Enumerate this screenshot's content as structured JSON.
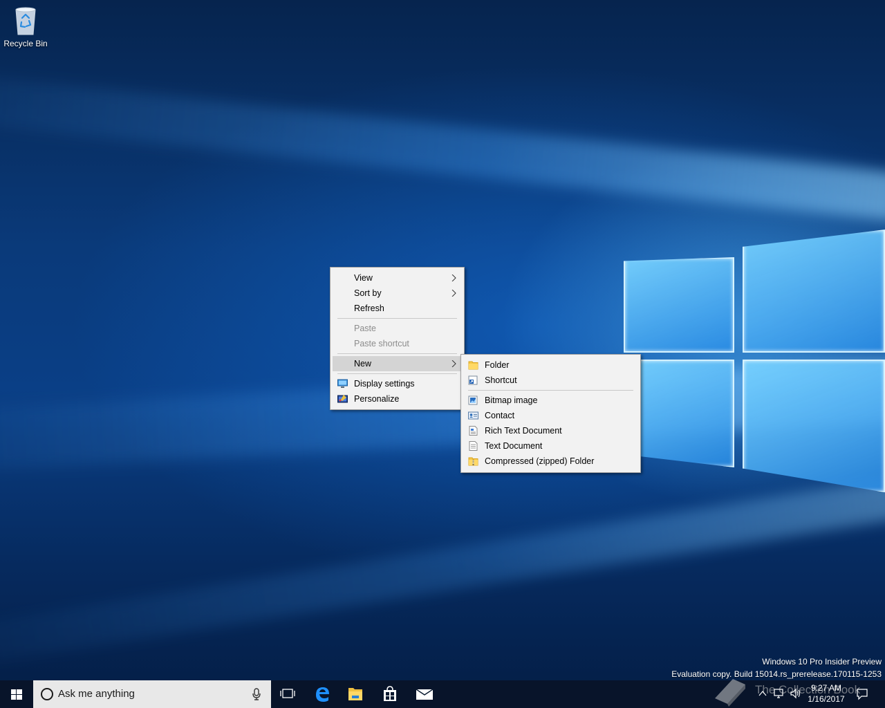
{
  "desktop": {
    "icons": [
      {
        "label": "Recycle Bin",
        "icon": "recycle-bin-icon"
      }
    ],
    "watermark": {
      "line1": "Windows 10 Pro Insider Preview",
      "line2": "Evaluation copy. Build 15014.rs_prerelease.170115-1253"
    }
  },
  "context_menu": {
    "items": [
      {
        "label": "View",
        "submenu": true,
        "enabled": true
      },
      {
        "label": "Sort by",
        "submenu": true,
        "enabled": true
      },
      {
        "label": "Refresh",
        "enabled": true
      },
      {
        "label": "Paste",
        "enabled": false
      },
      {
        "label": "Paste shortcut",
        "enabled": false
      },
      {
        "label": "New",
        "submenu": true,
        "enabled": true,
        "highlighted": true
      },
      {
        "label": "Display settings",
        "icon": "display-icon",
        "enabled": true
      },
      {
        "label": "Personalize",
        "icon": "personalize-icon",
        "enabled": true
      }
    ]
  },
  "new_submenu": {
    "items": [
      {
        "label": "Folder",
        "icon": "folder-icon"
      },
      {
        "label": "Shortcut",
        "icon": "shortcut-icon"
      },
      {
        "label": "Bitmap image",
        "icon": "bitmap-icon"
      },
      {
        "label": "Contact",
        "icon": "contact-icon"
      },
      {
        "label": "Rich Text Document",
        "icon": "rtf-document-icon"
      },
      {
        "label": "Text Document",
        "icon": "text-document-icon"
      },
      {
        "label": "Compressed (zipped) Folder",
        "icon": "zip-folder-icon"
      }
    ]
  },
  "taskbar": {
    "search_placeholder": "Ask me anything",
    "pinned": [
      "task-view-icon",
      "edge-icon",
      "file-explorer-icon",
      "store-icon",
      "mail-icon"
    ],
    "clock": {
      "time": "9:27 AM",
      "date": "1/16/2017"
    },
    "overlay_watermark": "The Collection Book"
  },
  "colors": {
    "accent": "#0078d7",
    "menu_bg": "#f2f2f2",
    "menu_highlight": "#d4d4d4",
    "taskbar_bg": "#08142a"
  }
}
